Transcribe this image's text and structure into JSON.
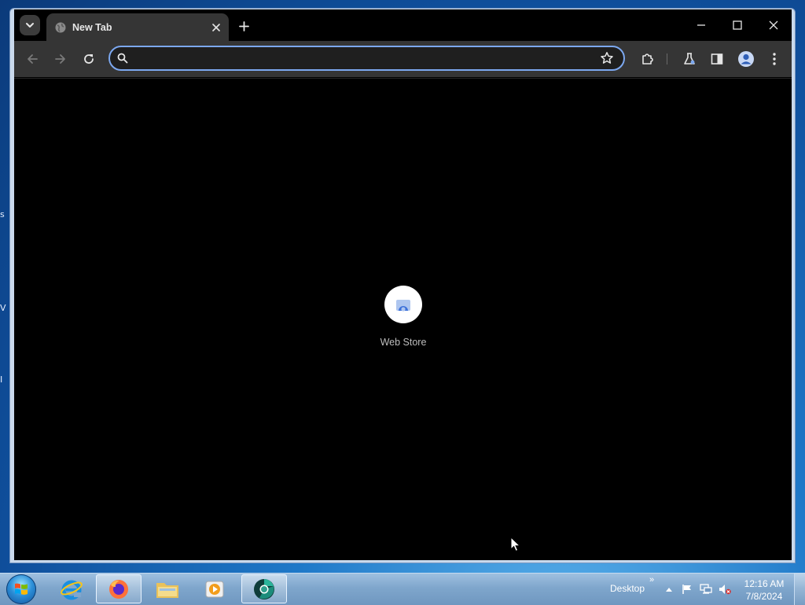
{
  "desktop_edge_glyphs": [
    "s",
    "V",
    "I"
  ],
  "browser": {
    "tab": {
      "title": "New Tab"
    },
    "omnibox": {
      "value": "",
      "placeholder": ""
    },
    "shortcuts": [
      {
        "label": "Web Store"
      }
    ],
    "colors": {
      "frame": "#000000",
      "toolbar": "#353535",
      "accent": "#7ca8f0"
    }
  },
  "taskbar": {
    "apps": [
      {
        "name": "internet-explorer"
      },
      {
        "name": "firefox"
      },
      {
        "name": "file-explorer"
      },
      {
        "name": "media-player"
      },
      {
        "name": "chrome-canary"
      }
    ],
    "tray": {
      "desktop_label": "Desktop",
      "chevron": "»"
    },
    "clock": {
      "time": "12:16 AM",
      "date": "7/8/2024"
    }
  }
}
